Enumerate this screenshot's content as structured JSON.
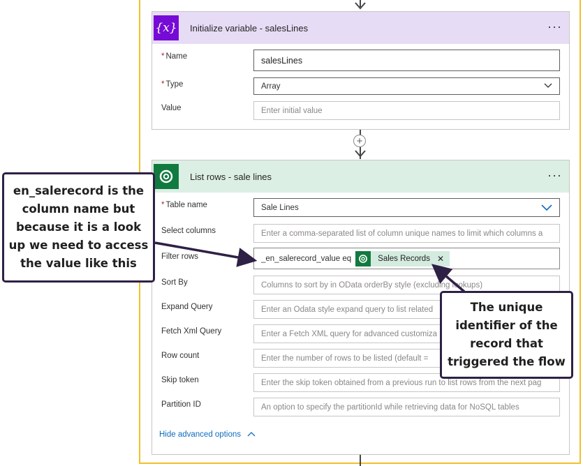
{
  "init_card": {
    "title": "Initialize variable - salesLines",
    "icon": "variable-icon",
    "header_color": "#e7dcf6",
    "icon_color": "#770bd6",
    "more": "···",
    "fields": {
      "name_label": "Name",
      "name_value": "salesLines",
      "type_label": "Type",
      "type_value": "Array",
      "value_label": "Value",
      "value_placeholder": "Enter initial value"
    }
  },
  "list_card": {
    "title": "List rows - sale lines",
    "icon": "dataverse-icon",
    "header_color": "#dcefe4",
    "icon_color": "#117a3f",
    "more": "···",
    "fields": {
      "table_label": "Table name",
      "table_value": "Sale Lines",
      "select_label": "Select columns",
      "select_placeholder": "Enter a comma-separated list of column unique names to limit which columns a",
      "filter_label": "Filter rows",
      "filter_value": "_en_salerecord_value eq",
      "filter_token": "Sales Records",
      "sort_label": "Sort By",
      "sort_placeholder": "Columns to sort by in OData orderBy style (excluding lookups)",
      "expand_label": "Expand Query",
      "expand_placeholder": "Enter an Odata style expand query to list related",
      "fetch_label": "Fetch Xml Query",
      "fetch_placeholder": "Enter a Fetch XML query for advanced customiza",
      "rowcount_label": "Row count",
      "rowcount_placeholder": "Enter the number of rows to be listed (default =",
      "skip_label": "Skip token",
      "skip_placeholder": "Enter the skip token obtained from a previous run to list rows from the next pag",
      "partition_label": "Partition ID",
      "partition_placeholder": "An option to specify the partitionId while retrieving data for NoSQL tables"
    },
    "hide_advanced": "Hide advanced options"
  },
  "annotations": {
    "left": "en_salerecord is the column name but because it is a look up we need to access the value like this",
    "right": "The unique identifier of the record that triggered the flow"
  },
  "colors": {
    "frame": "#f2c029",
    "callout_border": "#2f2046",
    "link": "#0f6cbd"
  }
}
